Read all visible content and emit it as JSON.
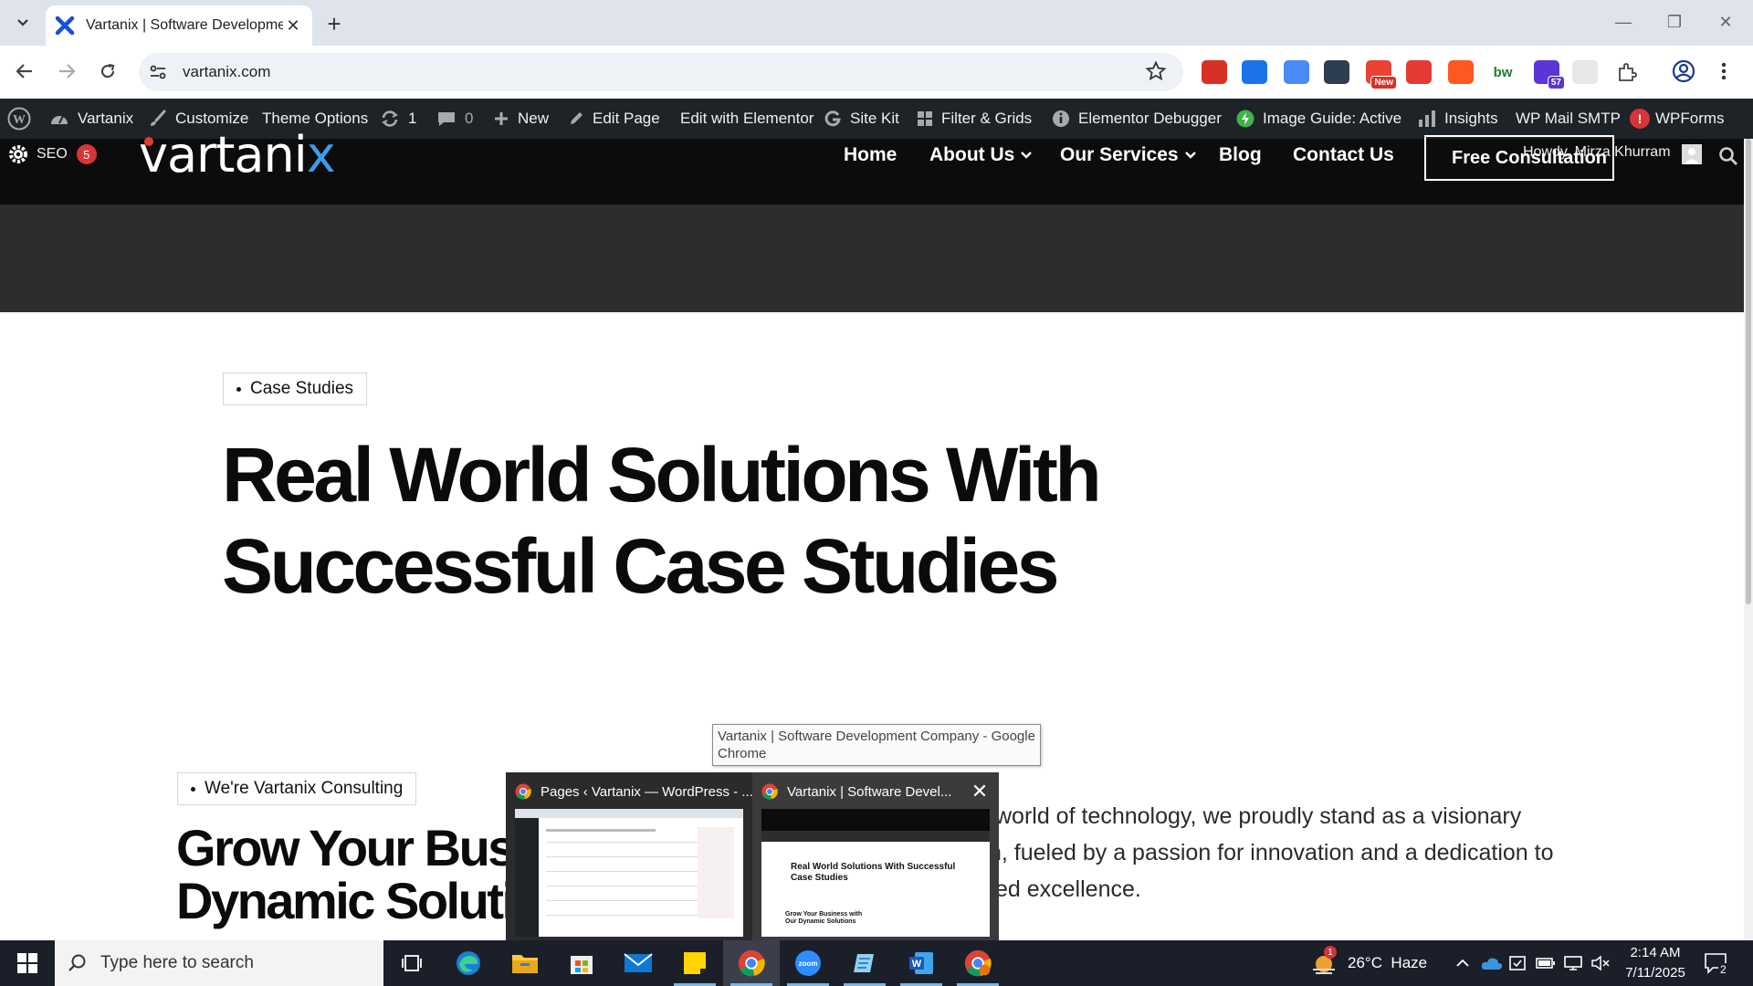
{
  "browser": {
    "tab_title": "Vartanix | Software Developmer",
    "tab_close": "✕",
    "new_tab": "+",
    "url": "vartanix.com",
    "window_controls": {
      "minimize": "—",
      "restore": "❐",
      "close": "✕"
    },
    "extensions": [
      {
        "name": "pdf-extension-icon",
        "color": "#d93025"
      },
      {
        "name": "shield-extension-icon",
        "color": "#1a73e8"
      },
      {
        "name": "docs-extension-icon",
        "color": "#4a8af4"
      },
      {
        "name": "folder-extension-icon",
        "color": "#2c3e50"
      },
      {
        "name": "new-extension-icon",
        "color": "#ea4335",
        "badge": "New"
      },
      {
        "name": "pokeball-extension-icon",
        "color": "#e53935"
      },
      {
        "name": "y-extension-icon",
        "color": "#ff5722"
      },
      {
        "name": "bw-extension-icon",
        "color": "#1e7e34",
        "label": "bw"
      },
      {
        "name": "hat-extension-icon",
        "color": "#5b35d5",
        "badge": "57"
      },
      {
        "name": "blank-extension-icon",
        "color": "#e8e8e8"
      },
      {
        "name": "puzzle-icon",
        "color": "#444"
      }
    ]
  },
  "adminbar": {
    "items": [
      {
        "label": "Vartanix"
      },
      {
        "label": "Customize"
      },
      {
        "label": "Theme Options"
      },
      {
        "label": "1"
      },
      {
        "label": "0"
      },
      {
        "label": "New"
      },
      {
        "label": "Edit Page"
      },
      {
        "label": "Edit with Elementor"
      },
      {
        "label": "Site Kit"
      },
      {
        "label": "Filter & Grids"
      },
      {
        "label": "Elementor Debugger"
      },
      {
        "label": "Image Guide: Active"
      },
      {
        "label": "Insights"
      },
      {
        "label": "WP Mail SMTP"
      },
      {
        "label": "WPForms"
      }
    ],
    "smtp_alert": "!",
    "howdy": "Howdy, Mirza Khurram",
    "seo_label": "SEO",
    "seo_count": "5"
  },
  "site": {
    "logo_text": "vartani",
    "logo_x": "x",
    "nav": [
      "Home",
      "About Us",
      "Our Services",
      "Blog",
      "Contact Us"
    ],
    "cta": "Free Consultation",
    "hero_tag": "Case Studies",
    "hero_title": "Real World Solutions With Successful Case Studies",
    "section_tag": "We're Vartanix Consulting",
    "section_title": "Grow Your Busi Dynamic Solutio",
    "section_paragraph": "world of technology, we proudly stand as a visionary\nn, fueled by a passion for innovation and a dedication to\ned excellence."
  },
  "tooltip": "Vartanix | Software Development Company - Google Chrome",
  "thumbnails": [
    {
      "title": "Pages ‹ Vartanix — WordPress - ..."
    },
    {
      "title": "Vartanix | Software Devel...",
      "preview_title": "Real World Solutions With Successful Case Studies",
      "preview_sub": "Grow Your Business with Our Dynamic Solutions"
    }
  ],
  "taskbar": {
    "search_placeholder": "Type here to search",
    "weather": "26°C  Haze",
    "weather_badge": "1",
    "time": "2:14 AM",
    "date": "7/11/2025",
    "notifications": "2"
  }
}
